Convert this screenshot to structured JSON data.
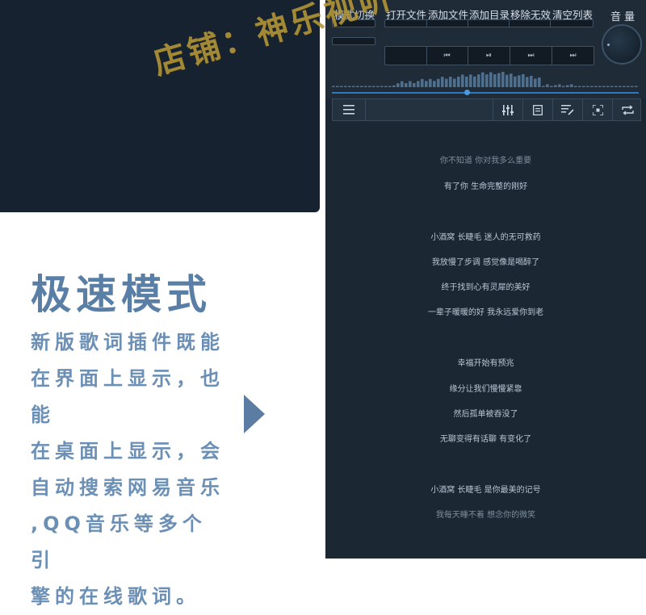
{
  "watermark": "店铺：神乐视听",
  "promo": {
    "title": "极速模式",
    "text": "新版歌词插件既能\n在界面上显示，也能\n在桌面上显示，会\n自动搜索网易音乐\n,QQ音乐等多个引\n擎的在线歌词。"
  },
  "player": {
    "top_buttons": {
      "mode": "模式切换",
      "open_file": "打开文件",
      "add_file": "添加文件",
      "add_dir": "添加目录",
      "remove_invalid": "移除无效",
      "clear_list": "清空列表",
      "volume": "音 量"
    },
    "controls": {
      "prev": "⏮",
      "play_pause": "⏯",
      "next": "⏭",
      "skip": "⏭"
    },
    "seek": {
      "progress": 0.44
    },
    "toolbar_icons": [
      "menu-icon",
      "equalizer-icon",
      "playlist-icon",
      "edit-lyrics-icon",
      "fullscreen-icon",
      "repeat-icon"
    ],
    "lyrics": [
      {
        "text": "你不知道 你对我多么重要",
        "dim": true
      },
      {
        "text": "有了你 生命完整的刚好",
        "dim": false
      },
      {
        "text": "小酒窝 长睫毛 迷人的无可救药",
        "dim": false
      },
      {
        "text": "我放慢了步调 感觉像是喝醉了",
        "dim": false
      },
      {
        "text": "终于找到心有灵犀的美好",
        "dim": false
      },
      {
        "text": "一辈子暖暖的好 我永远爱你到老",
        "dim": false
      },
      {
        "text": "幸福开始有预兆",
        "dim": false
      },
      {
        "text": "缘分让我们慢慢紧靠",
        "dim": false
      },
      {
        "text": "然后孤单被吞没了",
        "dim": false
      },
      {
        "text": "无聊变得有话聊 有变化了",
        "dim": false
      },
      {
        "text": "小酒窝 长睫毛 是你最美的记号",
        "dim": false
      },
      {
        "text": "我每天睡不着 想念你的微笑",
        "dim": true
      }
    ]
  }
}
